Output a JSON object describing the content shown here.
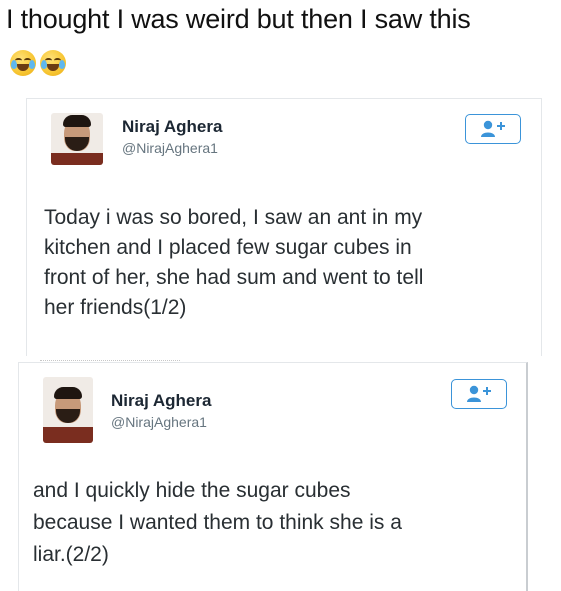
{
  "caption": "I thought I was weird but then I saw this",
  "caption_emojis": [
    "face-with-tears-of-joy-icon",
    "face-with-tears-of-joy-icon"
  ],
  "tweets": [
    {
      "name": "Niraj Aghera",
      "handle": "@NirajAghera1",
      "text_lines": [
        "Today i was so bored, I saw an ant in my",
        "kitchen and I placed few sugar cubes in",
        "front of her, she had sum and went to tell",
        "her friends(1/2)"
      ],
      "follow_icon": "follow-user-plus-icon"
    },
    {
      "name": "Niraj Aghera",
      "handle": "@NirajAghera1",
      "text_lines": [
        "and I quickly hide the sugar cubes",
        "because I wanted them to think she is a",
        "liar.(2/2)"
      ],
      "follow_icon": "follow-user-plus-icon"
    }
  ],
  "colors": {
    "follow_blue": "#3b94d9",
    "text": "#292f33",
    "handle": "#66757f",
    "border": "#e4e7ea"
  }
}
